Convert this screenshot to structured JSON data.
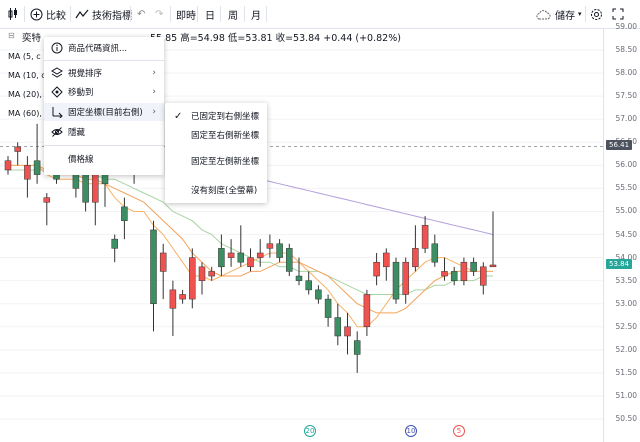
{
  "toolbar": {
    "compare_label": "比較",
    "indicators_label": "技術指標",
    "intervals": [
      "即時",
      "日",
      "周",
      "月"
    ],
    "save_label": "儲存"
  },
  "header": {
    "symbol": "奕特",
    "ohlc": "55.85 高=54.98 低=53.81 收=53.84 +0.44 (+0.82%)"
  },
  "legend": [
    "MA (5, c",
    "MA (10, c",
    "MA (20), c",
    "MA (60), c"
  ],
  "context_menu": {
    "items": [
      {
        "label": "商品代碼資訊...",
        "icon": "info-icon",
        "has_submenu": false
      },
      {
        "label": "視覺排序",
        "icon": "layers-icon",
        "has_submenu": true
      },
      {
        "label": "移動到",
        "icon": "move-icon",
        "has_submenu": true
      },
      {
        "label": "固定坐標(目前右側)",
        "icon": "pin-axis-icon",
        "has_submenu": true,
        "highlighted": true
      },
      {
        "label": "隱藏",
        "icon": "eye-off-icon",
        "has_submenu": false
      },
      {
        "label": "價格線",
        "icon": "",
        "has_submenu": false
      }
    ]
  },
  "submenu": {
    "items": [
      {
        "label": "已固定到右側坐標",
        "checked": true
      },
      {
        "label": "固定至右側新坐標",
        "checked": false
      },
      {
        "label": "固定至左側新坐標",
        "checked": false
      },
      {
        "label": "沒有刻度(全螢幕)",
        "checked": false
      }
    ]
  },
  "price_axis": {
    "labels": [
      "59.00",
      "58.50",
      "58.00",
      "57.50",
      "57.00",
      "56.50",
      "56.00",
      "55.50",
      "55.00",
      "54.50",
      "54.00",
      "53.50",
      "53.00",
      "52.50",
      "52.00",
      "51.50",
      "51.00",
      "50.50"
    ],
    "crosshair_price": "56.41",
    "last_price": "53.84"
  },
  "events": [
    {
      "label": "20",
      "color": "#26a69a"
    },
    {
      "label": "10",
      "color": "#3f51b5"
    },
    {
      "label": "5",
      "color": "#ef5350"
    }
  ],
  "colors": {
    "up": "#ef5350",
    "down": "#26a69a",
    "ma5": "#f7b267",
    "ma10": "#f4a259",
    "ma20": "#a8d5a2",
    "ma60": "#b39ddb",
    "bull_body": "#ef5350",
    "bear_body": "#3e8e63"
  },
  "chart_data": {
    "type": "candlestick",
    "ylim": [
      50.5,
      59.0
    ],
    "candles": [
      {
        "o": 55.9,
        "h": 56.2,
        "l": 55.8,
        "c": 56.1
      },
      {
        "o": 56.3,
        "h": 56.5,
        "l": 56.0,
        "c": 56.4
      },
      {
        "o": 55.7,
        "h": 56.2,
        "l": 55.3,
        "c": 56.0
      },
      {
        "o": 56.1,
        "h": 56.9,
        "l": 55.6,
        "c": 55.8
      },
      {
        "o": 55.2,
        "h": 55.4,
        "l": 54.7,
        "c": 55.3
      },
      {
        "o": 56.0,
        "h": 56.3,
        "l": 55.6,
        "c": 55.7
      },
      {
        "o": 56.4,
        "h": 56.8,
        "l": 56.1,
        "c": 56.2
      },
      {
        "o": 56.1,
        "h": 56.3,
        "l": 55.3,
        "c": 55.5
      },
      {
        "o": 55.8,
        "h": 56.1,
        "l": 55.0,
        "c": 55.2
      },
      {
        "o": 55.2,
        "h": 56.4,
        "l": 54.7,
        "c": 56.2
      },
      {
        "o": 56.1,
        "h": 56.4,
        "l": 55.1,
        "c": 55.6
      },
      {
        "o": 54.4,
        "h": 54.5,
        "l": 53.9,
        "c": 54.2
      },
      {
        "o": 55.1,
        "h": 55.3,
        "l": 54.4,
        "c": 54.8
      },
      {
        "o": 56.0,
        "h": 56.2,
        "l": 55.6,
        "c": 55.9
      },
      {
        "o": 56.3,
        "h": 56.4,
        "l": 56.0,
        "c": 56.2
      },
      {
        "o": 54.6,
        "h": 54.8,
        "l": 52.4,
        "c": 53.0
      },
      {
        "o": 53.7,
        "h": 54.3,
        "l": 53.1,
        "c": 54.1
      },
      {
        "o": 52.9,
        "h": 53.5,
        "l": 52.3,
        "c": 53.3
      },
      {
        "o": 53.1,
        "h": 53.3,
        "l": 53.0,
        "c": 53.2
      },
      {
        "o": 53.1,
        "h": 54.2,
        "l": 52.9,
        "c": 54.0
      },
      {
        "o": 53.5,
        "h": 53.9,
        "l": 53.2,
        "c": 53.8
      },
      {
        "o": 53.6,
        "h": 53.8,
        "l": 53.5,
        "c": 53.7
      },
      {
        "o": 54.2,
        "h": 54.5,
        "l": 53.6,
        "c": 53.8
      },
      {
        "o": 54.0,
        "h": 54.4,
        "l": 53.8,
        "c": 54.1
      },
      {
        "o": 54.1,
        "h": 54.7,
        "l": 53.8,
        "c": 53.9
      },
      {
        "o": 53.8,
        "h": 54.2,
        "l": 53.7,
        "c": 54.0
      },
      {
        "o": 54.0,
        "h": 54.4,
        "l": 53.8,
        "c": 54.1
      },
      {
        "o": 54.2,
        "h": 54.5,
        "l": 54.0,
        "c": 54.3
      },
      {
        "o": 54.3,
        "h": 54.4,
        "l": 53.9,
        "c": 54.0
      },
      {
        "o": 54.2,
        "h": 54.3,
        "l": 53.6,
        "c": 53.7
      },
      {
        "o": 53.6,
        "h": 54.0,
        "l": 53.4,
        "c": 53.5
      },
      {
        "o": 53.5,
        "h": 53.7,
        "l": 53.2,
        "c": 53.3
      },
      {
        "o": 53.3,
        "h": 53.4,
        "l": 53.0,
        "c": 53.1
      },
      {
        "o": 53.1,
        "h": 53.2,
        "l": 52.5,
        "c": 52.7
      },
      {
        "o": 52.7,
        "h": 53.0,
        "l": 52.1,
        "c": 52.3
      },
      {
        "o": 52.3,
        "h": 52.8,
        "l": 51.9,
        "c": 52.5
      },
      {
        "o": 52.2,
        "h": 52.4,
        "l": 51.5,
        "c": 51.9
      },
      {
        "o": 52.5,
        "h": 53.3,
        "l": 52.3,
        "c": 53.2
      },
      {
        "o": 53.6,
        "h": 54.1,
        "l": 53.4,
        "c": 53.9
      },
      {
        "o": 53.8,
        "h": 54.2,
        "l": 53.5,
        "c": 54.1
      },
      {
        "o": 53.9,
        "h": 54.0,
        "l": 53.0,
        "c": 53.1
      },
      {
        "o": 53.2,
        "h": 54.0,
        "l": 53.0,
        "c": 53.9
      },
      {
        "o": 53.8,
        "h": 54.7,
        "l": 53.7,
        "c": 54.2
      },
      {
        "o": 54.2,
        "h": 54.9,
        "l": 54.1,
        "c": 54.7
      },
      {
        "o": 54.3,
        "h": 54.5,
        "l": 53.8,
        "c": 53.9
      },
      {
        "o": 53.6,
        "h": 54.0,
        "l": 53.5,
        "c": 53.7
      },
      {
        "o": 53.7,
        "h": 53.8,
        "l": 53.4,
        "c": 53.5
      },
      {
        "o": 53.5,
        "h": 54.0,
        "l": 53.4,
        "c": 53.9
      },
      {
        "o": 53.9,
        "h": 54.0,
        "l": 53.6,
        "c": 53.7
      },
      {
        "o": 53.4,
        "h": 53.9,
        "l": 53.2,
        "c": 53.8
      },
      {
        "o": 53.8,
        "h": 55.0,
        "l": 53.8,
        "c": 53.84
      }
    ],
    "ma5": [
      56.0,
      56.0,
      56.0,
      56.0,
      55.8,
      55.7,
      55.7,
      55.7,
      55.6,
      55.6,
      55.6,
      55.3,
      55.1,
      55.0,
      55.0,
      54.7,
      54.5,
      54.2,
      53.9,
      53.6,
      53.6,
      53.5,
      53.6,
      53.7,
      53.8,
      53.9,
      54.0,
      54.1,
      54.1,
      54.1,
      53.9,
      53.7,
      53.5,
      53.3,
      53.0,
      52.8,
      52.5,
      52.5,
      52.7,
      53.0,
      53.3,
      53.5,
      53.7,
      53.9,
      54.0,
      54.0,
      53.9,
      53.8,
      53.7,
      53.7,
      53.7
    ],
    "ma10": [
      56.0,
      56.0,
      56.0,
      56.0,
      55.9,
      55.8,
      55.8,
      55.8,
      55.7,
      55.7,
      55.6,
      55.5,
      55.4,
      55.3,
      55.2,
      55.0,
      54.8,
      54.6,
      54.4,
      54.1,
      53.9,
      53.7,
      53.6,
      53.6,
      53.6,
      53.7,
      53.7,
      53.8,
      53.9,
      53.9,
      53.9,
      53.8,
      53.7,
      53.6,
      53.4,
      53.2,
      53.0,
      52.9,
      52.8,
      52.8,
      52.8,
      52.9,
      53.1,
      53.3,
      53.5,
      53.6,
      53.7,
      53.7,
      53.7,
      53.7,
      53.7
    ],
    "ma20": [
      55.9,
      55.9,
      55.9,
      55.9,
      55.9,
      55.9,
      55.9,
      55.9,
      55.8,
      55.8,
      55.7,
      55.7,
      55.6,
      55.5,
      55.4,
      55.3,
      55.2,
      55.0,
      54.9,
      54.8,
      54.6,
      54.5,
      54.3,
      54.2,
      54.1,
      54.0,
      53.9,
      53.9,
      53.8,
      53.8,
      53.7,
      53.7,
      53.7,
      53.6,
      53.5,
      53.4,
      53.3,
      53.2,
      53.2,
      53.2,
      53.2,
      53.2,
      53.3,
      53.3,
      53.4,
      53.4,
      53.5,
      53.5,
      53.5,
      53.6,
      53.6
    ],
    "ma60": [
      null,
      null,
      null,
      null,
      null,
      null,
      null,
      null,
      null,
      null,
      null,
      null,
      null,
      null,
      null,
      null,
      null,
      null,
      null,
      null,
      null,
      null,
      null,
      null,
      55.8,
      55.75,
      55.7,
      55.65,
      55.6,
      55.55,
      55.5,
      55.45,
      55.4,
      55.35,
      55.3,
      55.25,
      55.2,
      55.15,
      55.1,
      55.05,
      55.0,
      54.95,
      54.9,
      54.85,
      54.8,
      54.75,
      54.7,
      54.65,
      54.6,
      54.55,
      54.5
    ]
  }
}
